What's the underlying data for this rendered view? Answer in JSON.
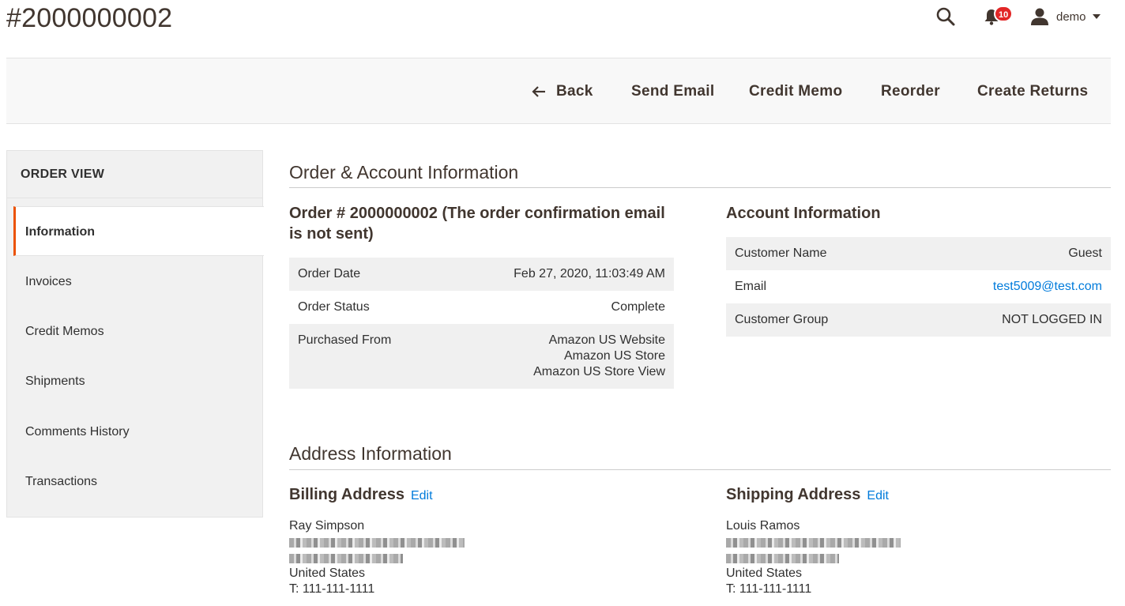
{
  "page": {
    "title": "#2000000002"
  },
  "header": {
    "notifications_count": "10",
    "user_name": "demo"
  },
  "toolbar": {
    "back_label": "Back",
    "send_email_label": "Send Email",
    "credit_memo_label": "Credit Memo",
    "reorder_label": "Reorder",
    "create_returns_label": "Create Returns"
  },
  "sidebar": {
    "heading": "ORDER VIEW",
    "items": [
      {
        "label": "Information",
        "active": true
      },
      {
        "label": "Invoices"
      },
      {
        "label": "Credit Memos"
      },
      {
        "label": "Shipments"
      },
      {
        "label": "Comments History"
      },
      {
        "label": "Transactions"
      }
    ]
  },
  "order_account": {
    "section_title": "Order & Account Information",
    "order": {
      "title": "Order # 2000000002 (The order confirmation email is not sent)",
      "rows": [
        {
          "label": "Order Date",
          "value": "Feb 27, 2020, 11:03:49 AM"
        },
        {
          "label": "Order Status",
          "value": "Complete"
        },
        {
          "label": "Purchased From",
          "values": [
            "Amazon US Website",
            "Amazon US Store",
            "Amazon US Store View"
          ]
        }
      ]
    },
    "account": {
      "title": "Account Information",
      "rows": [
        {
          "label": "Customer Name",
          "value": "Guest"
        },
        {
          "label": "Email",
          "value": "test5009@test.com"
        },
        {
          "label": "Customer Group",
          "value": "NOT LOGGED IN"
        }
      ]
    }
  },
  "address": {
    "section_title": "Address Information",
    "edit_label": "Edit",
    "billing": {
      "title": "Billing Address",
      "name": "Ray Simpson",
      "country": "United States",
      "phone": "T: 111-111-1111"
    },
    "shipping": {
      "title": "Shipping Address",
      "name": "Louis Ramos",
      "country": "United States",
      "phone": "T: 111-111-1111"
    }
  },
  "colors": {
    "accent": "#eb5202",
    "link": "#007bdb",
    "badge": "#e22626",
    "text_dark": "#41362f"
  }
}
